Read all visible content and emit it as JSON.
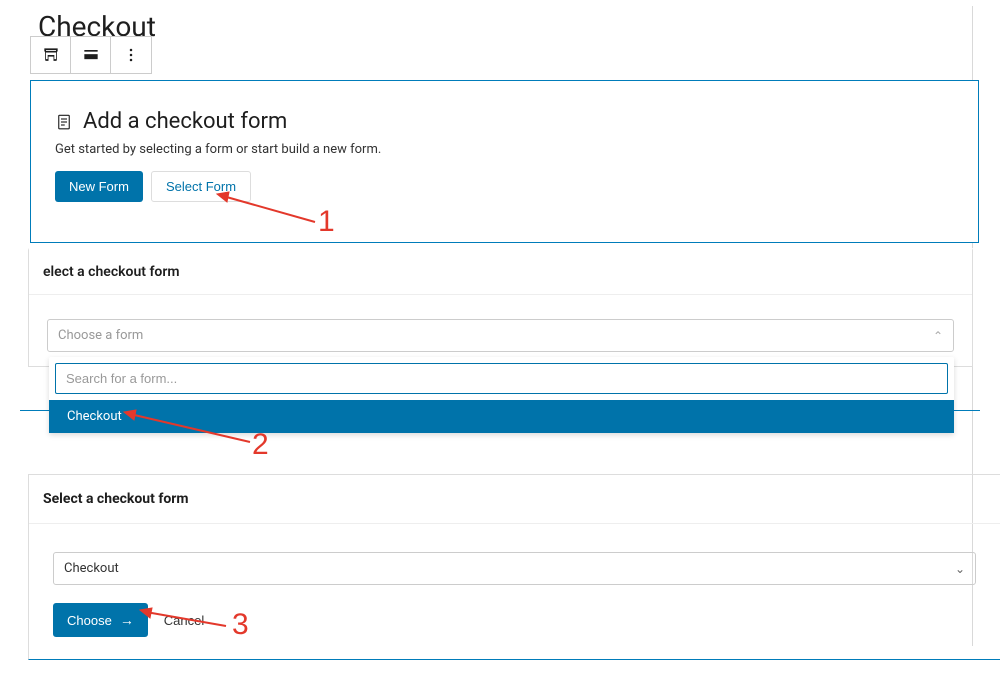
{
  "page": {
    "title": "Checkout"
  },
  "toolbar": {
    "item_block_type": "block-type",
    "item_align": "align",
    "item_more": "more-options"
  },
  "placeholder": {
    "title": "Add a checkout form",
    "description": "Get started by selecting a form or start build a new form.",
    "new_form_label": "New Form",
    "select_form_label": "Select Form"
  },
  "modal_a": {
    "title": "elect a checkout form",
    "combo_placeholder": "Choose a form",
    "search_placeholder": "Search for a form...",
    "option_checkout": "Checkout"
  },
  "modal_b": {
    "title": "Select a checkout form",
    "selected_value": "Checkout",
    "choose_label": "Choose",
    "cancel_label": "Cancel"
  },
  "annotations": {
    "n1": "1",
    "n2": "2",
    "n3": "3"
  },
  "colors": {
    "primary": "#0073aa",
    "border_focus": "#007cba",
    "annotation_red": "#e3382b"
  }
}
